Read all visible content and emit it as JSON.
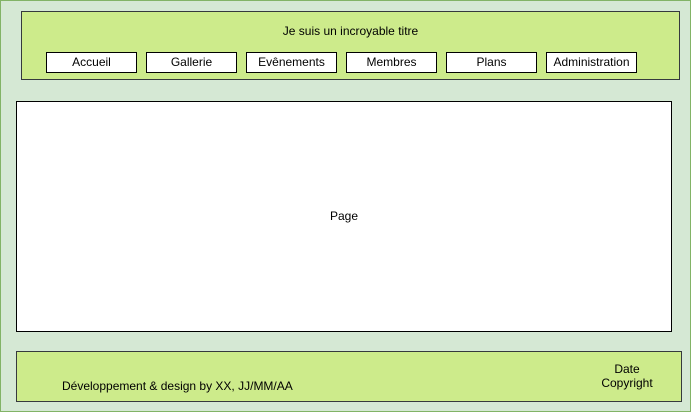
{
  "header": {
    "title": "Je suis un incroyable titre",
    "nav": [
      "Accueil",
      "Gallerie",
      "Evênements",
      "Membres",
      "Plans",
      "Administration"
    ]
  },
  "page": {
    "label": "Page"
  },
  "footer": {
    "credit": "Développement & design by XX, JJ/MM/AA",
    "date": "Date",
    "copyright": "Copyright"
  },
  "colors": {
    "background": "#d5e8d4",
    "band": "#cdeb8b",
    "box": "#ffffff"
  }
}
